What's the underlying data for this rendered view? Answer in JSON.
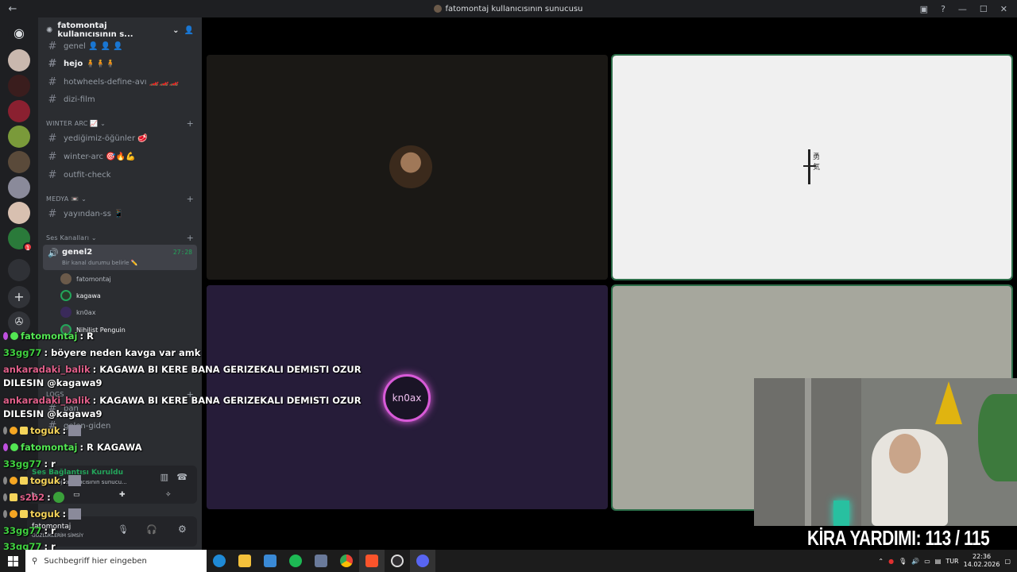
{
  "window": {
    "title": "fatomontaj kullanıcısının sunucusu"
  },
  "sidebar": {
    "guild_name": "fatomontaj kullanıcısının s...",
    "channels_top": [
      {
        "label": "genel 👤 👤 👤",
        "bright": false
      },
      {
        "label": "hejo 🧍🧍🧍",
        "bright": true
      },
      {
        "label": "hotwheels-define-avı 🏎️🏎️🏎️",
        "bright": false
      },
      {
        "label": "dizi-film",
        "bright": false
      }
    ],
    "cat_winter": "WINTER ARC 📈",
    "channels_winter": [
      {
        "label": "yediğimiz-öğünler 🥩"
      },
      {
        "label": "winter-arc 🎯🔥💪"
      },
      {
        "label": "outfit-check"
      }
    ],
    "cat_media": "MEDYA 📼",
    "channels_media": [
      {
        "label": "yayından-ss 📱"
      }
    ],
    "cat_voice": "Ses Kanalları",
    "voice_channel": {
      "name": "genel2",
      "timer": "27:28",
      "status": "Bir kanal durumu belirle ✏️"
    },
    "voice_users": [
      {
        "name": "fatomontaj"
      },
      {
        "name": "kagawa"
      },
      {
        "name": "kn0ax"
      },
      {
        "name": "Nihilist Penguin"
      }
    ],
    "cat_logs": "LOGS",
    "log_channels": [
      {
        "label": "ban"
      },
      {
        "label": "gelen-giden"
      }
    ]
  },
  "voice_panel": {
    "status": "Ses Bağlantısı Kuruldu",
    "server": "fatomontaj kullanıcısının sunucu..."
  },
  "user_panel": {
    "name": "fatomontaj",
    "status": "GÖZLÜKLERİM SİMSİY"
  },
  "stage": {
    "tiles": [
      {
        "label": "",
        "kind": "avatar"
      },
      {
        "label": "",
        "kind": "logo"
      },
      {
        "label": "kn0ax",
        "kind": "ring"
      },
      {
        "label": "",
        "kind": "blank"
      }
    ]
  },
  "chat": [
    {
      "user": "fatomontaj",
      "text": ": R",
      "color": "green"
    },
    {
      "user": "33gg77",
      "text": ": böyere neden kavga var amk",
      "color": "green2"
    },
    {
      "user": "ankaradaki_balik",
      "text": ": KAGAWA BI KERE BANA GERIZEKALI DEMISTI OZUR",
      "color": "pink"
    },
    {
      "user": "",
      "text": "DILESIN @kagawa9",
      "color": ""
    },
    {
      "user": "ankaradaki_balik",
      "text": ": KAGAWA BI KERE BANA GERIZEKALI DEMISTI OZUR",
      "color": "pink"
    },
    {
      "user": "",
      "text": "DILESIN @kagawa9",
      "color": ""
    },
    {
      "user": "toguk",
      "text": ":",
      "color": "yellow"
    },
    {
      "user": "fatomontaj",
      "text": ": R KAGAWA",
      "color": "green"
    },
    {
      "user": "33gg77",
      "text": ": r",
      "color": "green2"
    },
    {
      "user": "toguk",
      "text": ":",
      "color": "yellow"
    },
    {
      "user": "s2b2",
      "text": ":",
      "color": "pink"
    },
    {
      "user": "toguk",
      "text": ":",
      "color": "yellow"
    },
    {
      "user": "33gg77",
      "text": ": r",
      "color": "green2"
    },
    {
      "user": "33gg77",
      "text": ": r",
      "color": "green2"
    }
  ],
  "overlay": {
    "kira_text": "KİRA YARDIMI:  113 / 115"
  },
  "taskbar": {
    "search_placeholder": "Suchbegriff hier eingeben",
    "lang": "TUR",
    "time": "22:36",
    "date": "14.02.2026"
  },
  "colors": {
    "green_name": "#53e653",
    "pink_name": "#e0608a",
    "yellow_name": "#f5d45a",
    "speaking_outline": "#2c6e49"
  }
}
